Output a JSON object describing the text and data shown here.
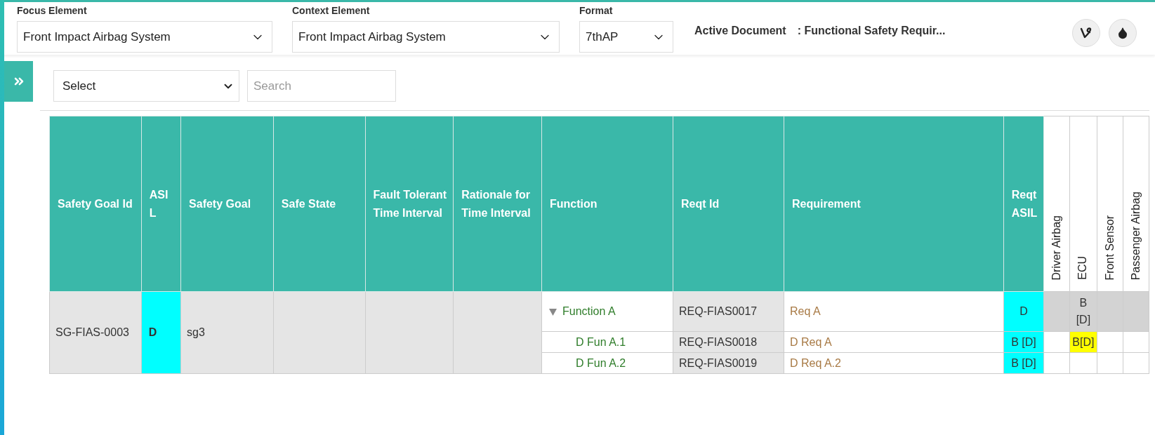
{
  "header": {
    "focus": {
      "label": "Focus Element",
      "value": "Front Impact Airbag System"
    },
    "context": {
      "label": "Context Element",
      "value": "Front Impact Airbag System"
    },
    "format": {
      "label": "Format",
      "value": "7thAP"
    },
    "active_document": {
      "label": "Active Document",
      "value": ": Functional Safety Requir..."
    }
  },
  "toolbar": {
    "select": {
      "value": "Select"
    },
    "search": {
      "placeholder": "Search"
    }
  },
  "table": {
    "columns": [
      {
        "label": "Safety Goal Id",
        "kind": "standard"
      },
      {
        "label": "ASIL",
        "kind": "standard"
      },
      {
        "label": "Safety Goal",
        "kind": "standard"
      },
      {
        "label": "Safe State",
        "kind": "standard"
      },
      {
        "label": "Fault Tolerant Time Interval",
        "kind": "standard"
      },
      {
        "label": "Rationale for Time Interval",
        "kind": "standard"
      },
      {
        "label": "Function",
        "kind": "standard"
      },
      {
        "label": "Reqt Id",
        "kind": "standard"
      },
      {
        "label": "Requirement",
        "kind": "standard"
      },
      {
        "label": "Reqt ASIL",
        "kind": "standard"
      },
      {
        "label": "Driver Airbag",
        "kind": "vertical"
      },
      {
        "label": "ECU",
        "kind": "vertical"
      },
      {
        "label": "Front Sensor",
        "kind": "vertical"
      },
      {
        "label": "Passenger Airbag",
        "kind": "vertical"
      }
    ],
    "rows": [
      {
        "goal_id": "SG-FIAS-0003",
        "asil": "D",
        "safety_goal": "sg3",
        "functions": [
          {
            "name": "Function A",
            "expanded": true,
            "reqt_id": "REQ-FIAS0017",
            "requirement": "Req A",
            "reqt_asil": "D",
            "allocations": [
              {
                "color": "#d3d3d3"
              },
              {
                "text": "B[D]",
                "color": "#d3d3d3"
              },
              {
                "color": "#d3d3d3"
              },
              {
                "color": "#d3d3d3"
              }
            ],
            "children": [
              {
                "name": "D Fun A.1",
                "reqt_id": "REQ-FIAS0018",
                "requirement": "D Req A",
                "reqt_asil": "B [D]",
                "allocations": [
                  {
                    "color": "#ffffff"
                  },
                  {
                    "text": "B[D]",
                    "color": "#ffff00"
                  },
                  {
                    "color": "#ffffff"
                  },
                  {
                    "color": "#ffffff"
                  }
                ]
              },
              {
                "name": "D Fun A.2",
                "reqt_id": "REQ-FIAS0019",
                "requirement": "D Req A.2",
                "reqt_asil": "B [D]",
                "allocations": [
                  {
                    "color": "#ffffff"
                  },
                  {
                    "color": "#ffffff"
                  },
                  {
                    "color": "#ffffff"
                  },
                  {
                    "color": "#ffffff"
                  }
                ]
              }
            ]
          }
        ]
      }
    ]
  }
}
